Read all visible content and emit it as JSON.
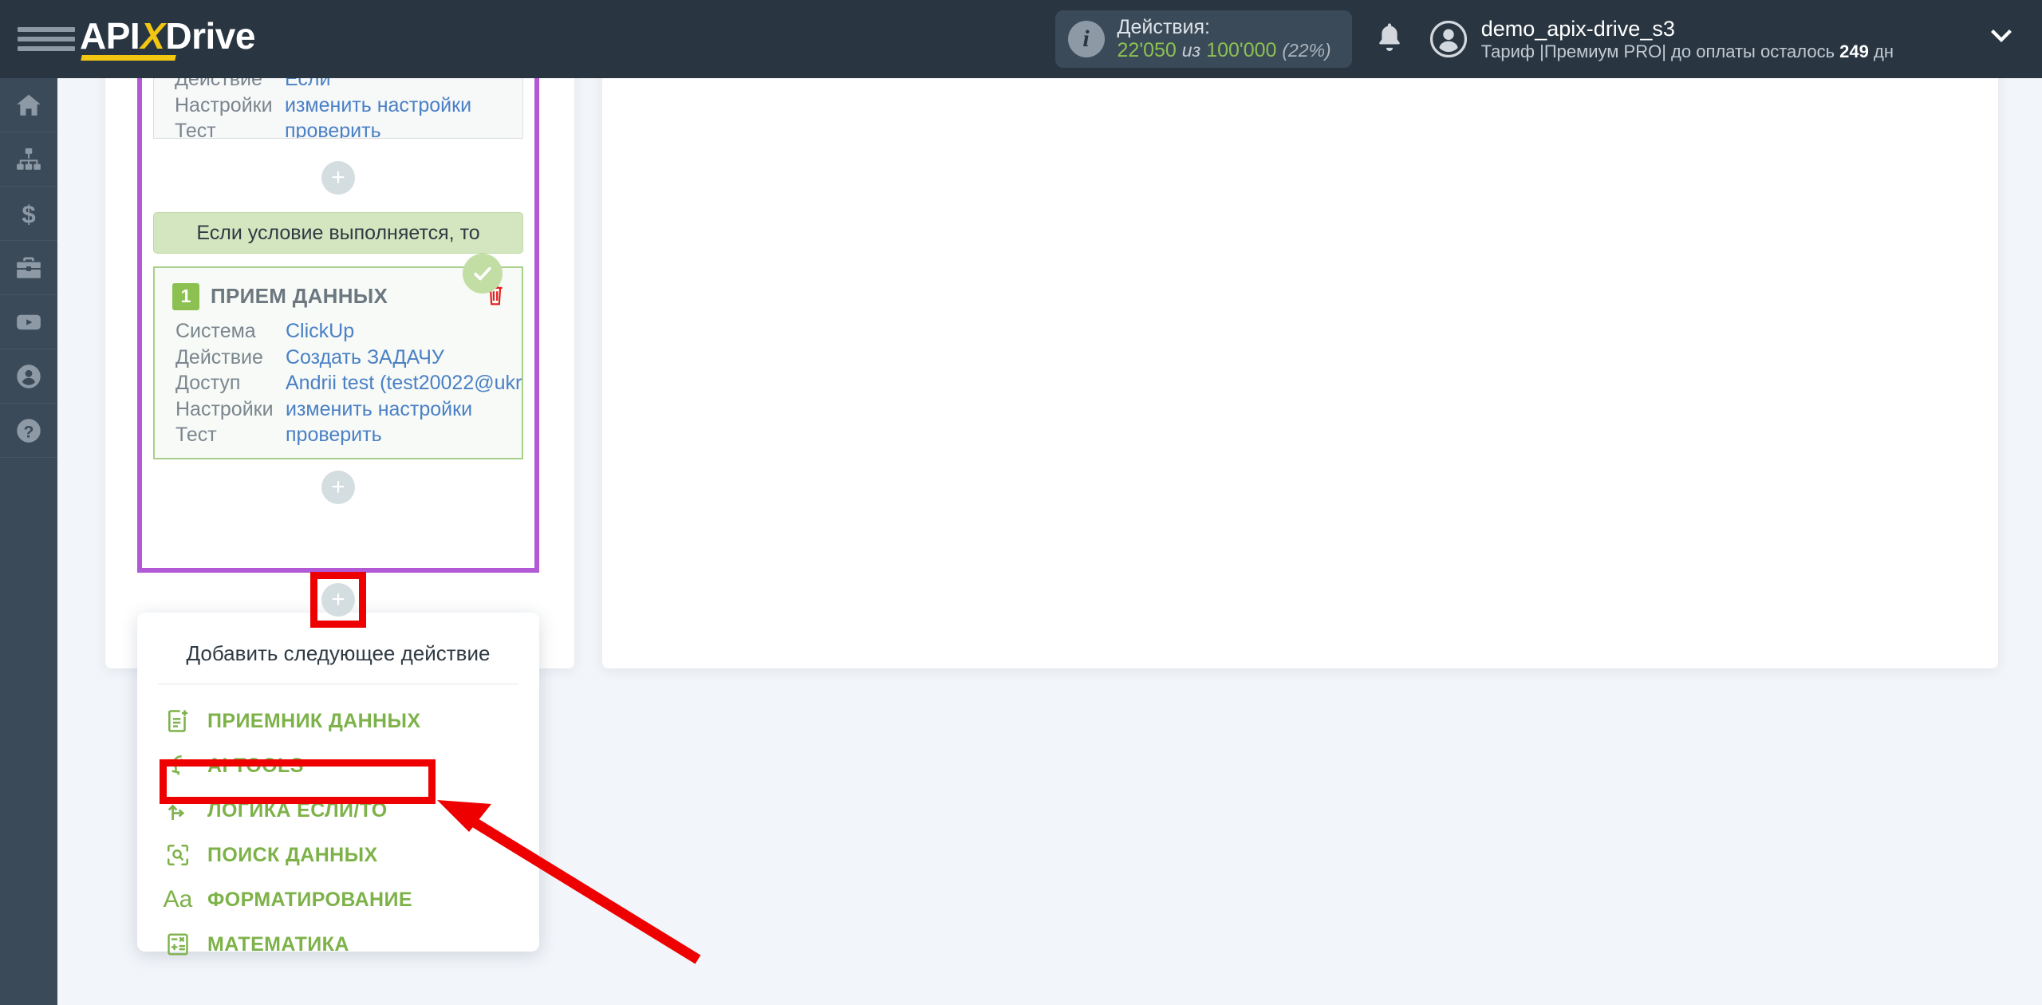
{
  "header": {
    "logo": {
      "part1": "API",
      "x": "X",
      "part2": "Drive"
    },
    "menu_icon": "hamburger-icon",
    "actions": {
      "title": "Действия:",
      "used": "22'050",
      "separator": "из",
      "total": "100'000",
      "percent": "(22%)"
    },
    "user": {
      "name": "demo_apix-drive_s3",
      "plan_prefix": "Тариф |Премиум PRO| до оплаты осталось ",
      "plan_days": "249",
      "plan_suffix": " дн"
    }
  },
  "sidebar": {
    "items": [
      {
        "icon": "home-icon",
        "name": "sidebar-item-home"
      },
      {
        "icon": "sitemap-icon",
        "name": "sidebar-item-connections"
      },
      {
        "icon": "dollar-icon",
        "name": "sidebar-item-billing"
      },
      {
        "icon": "briefcase-icon",
        "name": "sidebar-item-business"
      },
      {
        "icon": "youtube-icon",
        "name": "sidebar-item-video"
      },
      {
        "icon": "user-icon",
        "name": "sidebar-item-account"
      },
      {
        "icon": "help-icon",
        "name": "sidebar-item-help"
      }
    ]
  },
  "workflow": {
    "if_card": {
      "rows": [
        {
          "key": "Действие",
          "value": "Если"
        },
        {
          "key": "Настройки",
          "value": "изменить настройки"
        },
        {
          "key": "Тест",
          "value": "проверить"
        }
      ]
    },
    "condition_bar": "Если условие выполняется, то",
    "receiver_card": {
      "number": "1",
      "title": "ПРИЕМ ДАННЫХ",
      "delete_icon": "trash-icon",
      "status_icon": "check-circle-icon",
      "rows": [
        {
          "key": "Система",
          "value": "ClickUp"
        },
        {
          "key": "Действие",
          "value": "Создать ЗАДАЧУ"
        },
        {
          "key": "Доступ",
          "value": "Andrii test (test20022@ukr"
        },
        {
          "key": "Настройки",
          "value": "изменить настройки"
        },
        {
          "key": "Тест",
          "value": "проверить"
        }
      ]
    },
    "add_button_label": "+"
  },
  "dropdown": {
    "title": "Добавить следующее действие",
    "items": [
      {
        "label": "ПРИЕМНИК ДАННЫХ",
        "icon": "document-add-icon"
      },
      {
        "label": "AI TOOLS",
        "icon": "ai-brain-icon"
      },
      {
        "label": "ЛОГИКА ЕСЛИ/ТО",
        "icon": "branch-icon"
      },
      {
        "label": "ПОИСК ДАННЫХ",
        "icon": "search-scan-icon"
      },
      {
        "label": "ФОРМАТИРОВАНИЕ",
        "icon": "text-format-icon"
      },
      {
        "label": "МАТЕМАТИКА",
        "icon": "calculator-icon"
      }
    ]
  },
  "colors": {
    "brand_yellow": "#f3c611",
    "header_bg": "#293642",
    "sidebar_bg": "#3b4a58",
    "green": "#7db249",
    "link_blue": "#4a80c6",
    "purple_border": "#b259d6",
    "annotation_red": "#ef0000"
  }
}
